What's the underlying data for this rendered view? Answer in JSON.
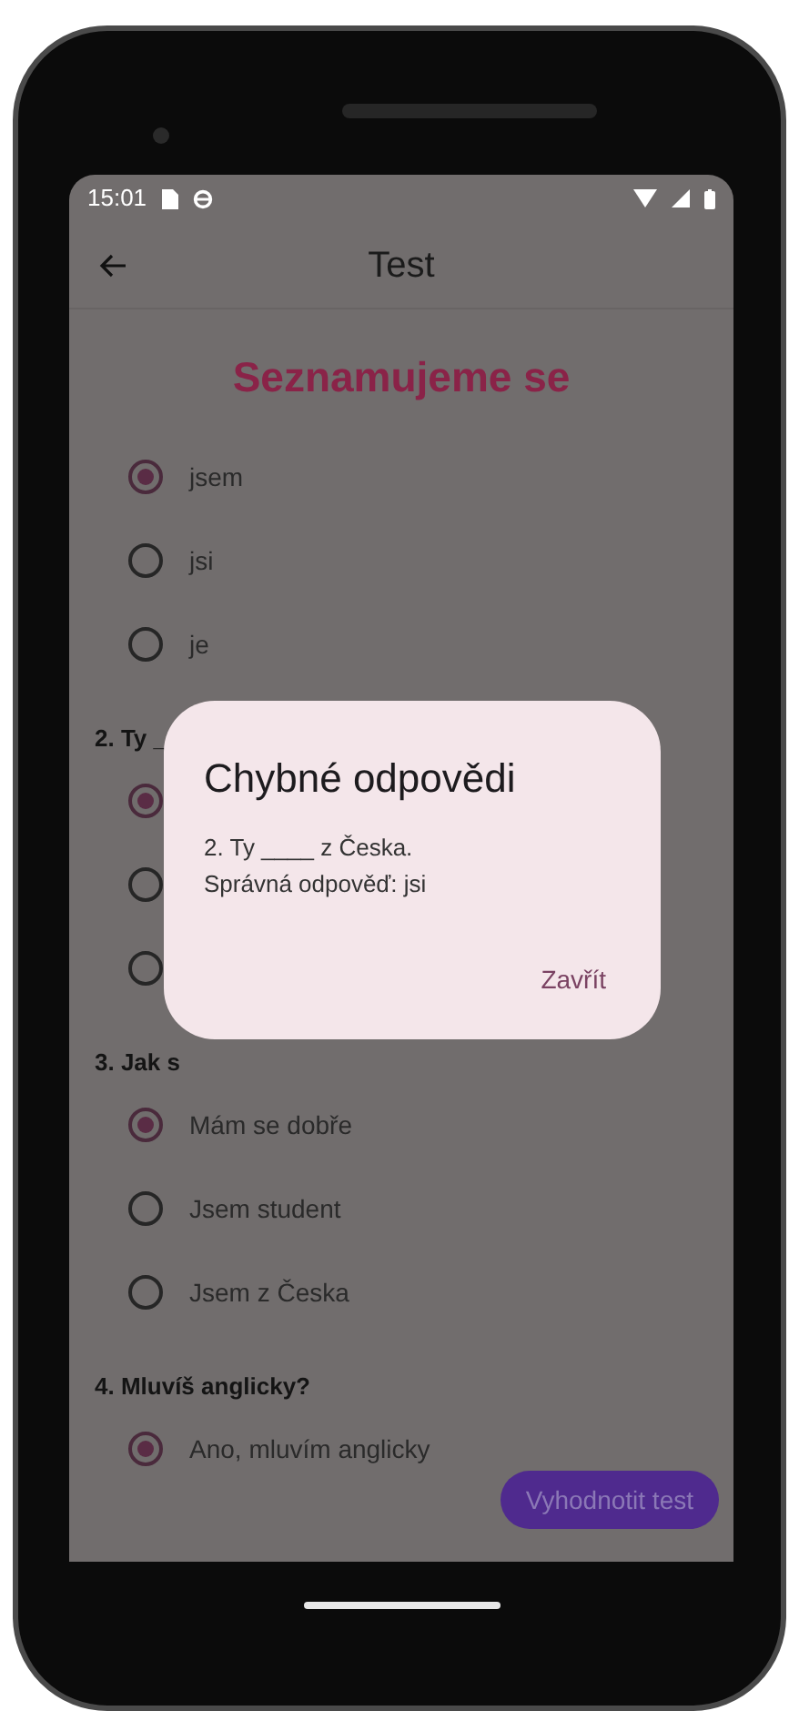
{
  "status_bar": {
    "time": "15:01"
  },
  "app_bar": {
    "title": "Test"
  },
  "heading": "Seznamujeme se",
  "questions": [
    {
      "options": [
        {
          "label": "jsem",
          "selected": true
        },
        {
          "label": "jsi",
          "selected": false
        },
        {
          "label": "je",
          "selected": false
        }
      ]
    },
    {
      "title": "2. Ty _",
      "options": [
        {
          "selected": true
        },
        {
          "selected": false
        },
        {
          "selected": false
        }
      ]
    },
    {
      "title": "3. Jak s",
      "options": [
        {
          "label": "Mám se dobře",
          "selected": true
        },
        {
          "label": "Jsem student",
          "selected": false
        },
        {
          "label": "Jsem z Česka",
          "selected": false
        }
      ]
    },
    {
      "title": "4. Mluvíš anglicky?",
      "options": [
        {
          "label": "Ano, mluvím anglicky",
          "selected": true
        }
      ]
    }
  ],
  "submit_button": "Vyhodnotit test",
  "dialog": {
    "title": "Chybné odpovědi",
    "lines": [
      "2. Ty ____ z Česka.",
      "Správná odpověď: jsi"
    ],
    "close_button": "Zavřít"
  }
}
